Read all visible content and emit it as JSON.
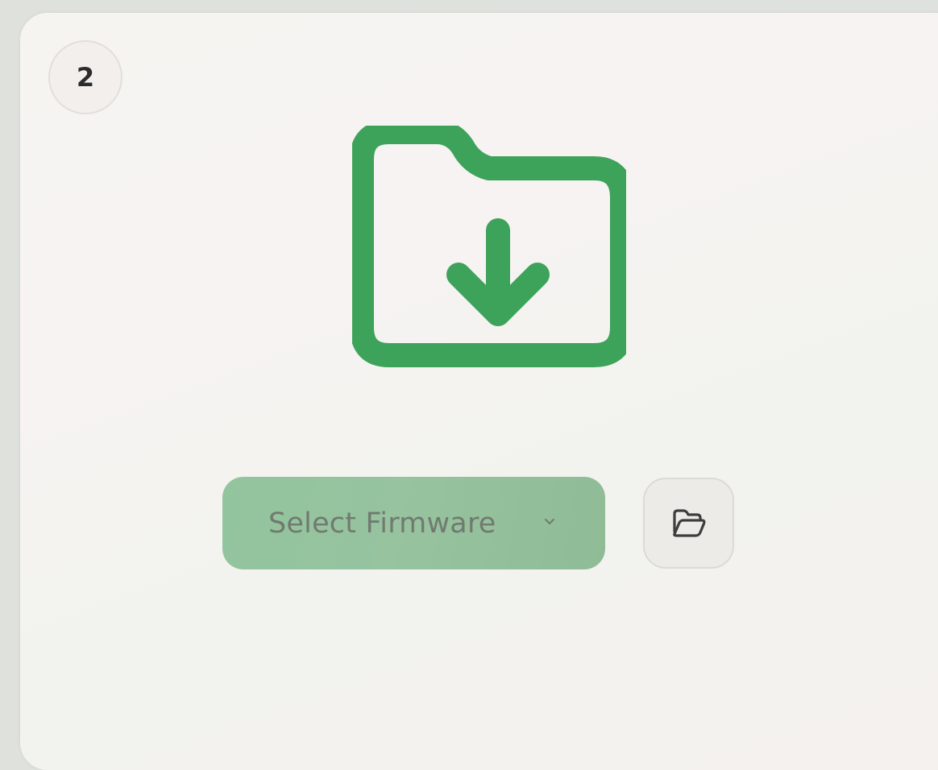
{
  "step": {
    "number": "2"
  },
  "hero": {
    "icon": "folder-download-icon",
    "color": "#3ea35a"
  },
  "firmware_select": {
    "label": "Select Firmware",
    "icon": "chevron-down-icon",
    "background": "#92c49e"
  },
  "browse_button": {
    "icon": "folder-open-icon"
  }
}
